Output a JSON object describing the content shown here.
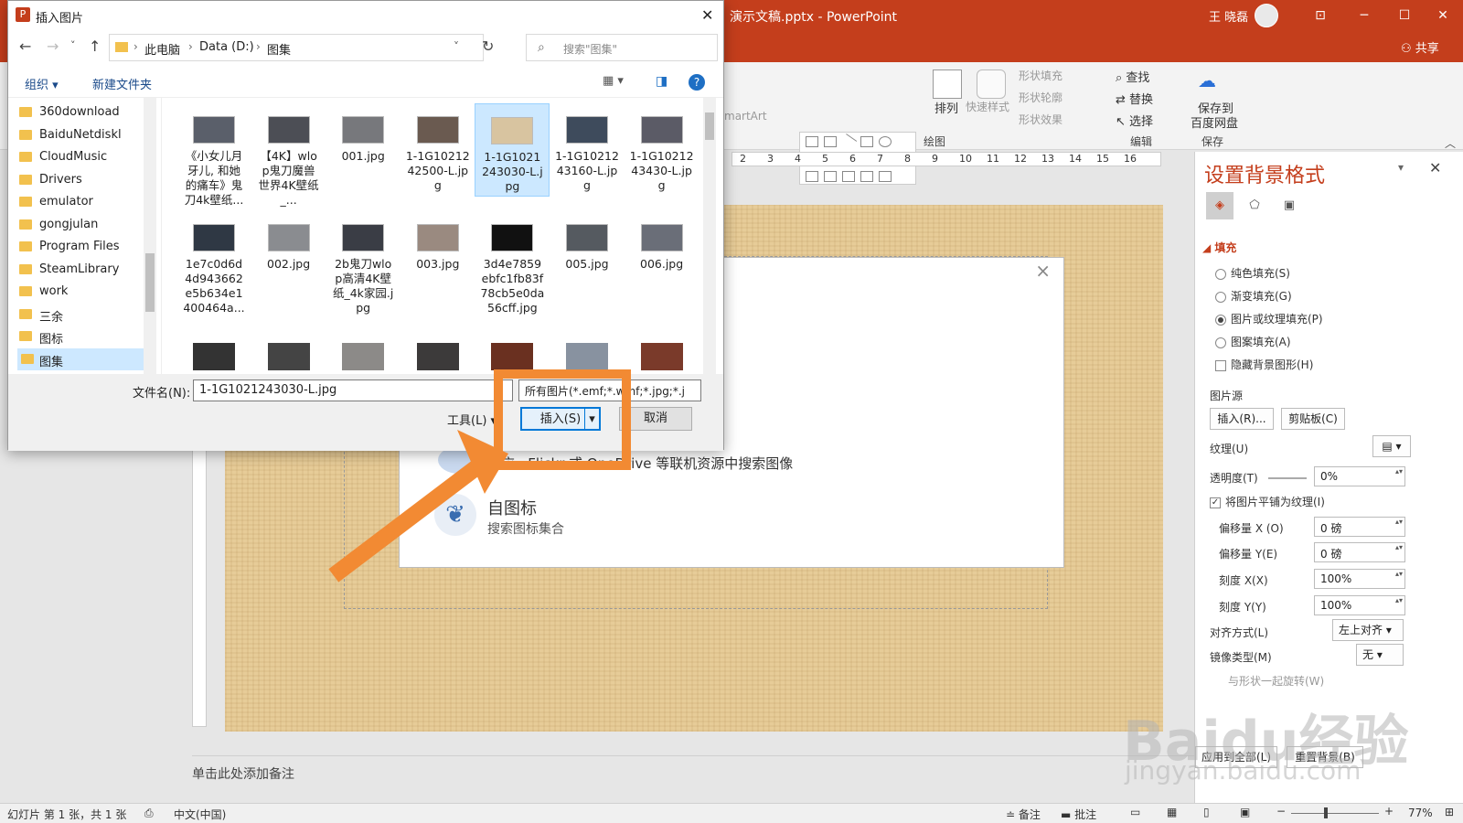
{
  "ppt": {
    "title": "演示文稿.pptx - PowerPoint",
    "user": "王 晓磊",
    "share": "共享",
    "ribbon": {
      "shape_fill": "形状填充",
      "shape_outline": "形状轮廓",
      "shape_effect": "形状效果",
      "arrange": "排列",
      "quick_styles": "快速样式",
      "find": "查找",
      "replace": "替换",
      "select": "选择",
      "save_to_baidu_line1": "保存到",
      "save_to_baidu_line2": "百度网盘",
      "group_drawing": "绘图",
      "group_edit": "编辑",
      "group_save": "保存",
      "smartart": "martArt"
    },
    "ruler_ticks": [
      "2",
      "3",
      "4",
      "5",
      "6",
      "7",
      "8",
      "9",
      "10",
      "11",
      "12",
      "13",
      "14",
      "15",
      "16"
    ],
    "notes_placeholder": "单击此处添加备注",
    "status": {
      "slide": "幻灯片 第 1 张，共 1 张",
      "lang": "中文(中国)",
      "notes": "备注",
      "comments": "批注",
      "zoom": "77%"
    }
  },
  "online_pictures": {
    "bing_text": "必应 · Flickr 或 OneDrive 等联机资源中搜索图像",
    "bing_partial": "Drive 等联机资源中搜索图像",
    "icons_title": "自图标",
    "icons_sub": "搜索图标集合"
  },
  "format_pane": {
    "title": "设置背景格式",
    "section_fill": "填充",
    "solid": "纯色填充(S)",
    "gradient": "渐变填充(G)",
    "picture_texture": "图片或纹理填充(P)",
    "pattern": "图案填充(A)",
    "hide_bg": "隐藏背景图形(H)",
    "picture_source": "图片源",
    "insert_btn": "插入(R)...",
    "clipboard_btn": "剪贴板(C)",
    "texture": "纹理(U)",
    "transparency": "透明度(T)",
    "transparency_val": "0%",
    "tile": "将图片平铺为纹理(I)",
    "offset_x": "偏移量 X (O)",
    "offset_x_val": "0 磅",
    "offset_y": "偏移量 Y(E)",
    "offset_y_val": "0 磅",
    "scale_x": "刻度 X(X)",
    "scale_x_val": "100%",
    "scale_y": "刻度 Y(Y)",
    "scale_y_val": "100%",
    "align": "对齐方式(L)",
    "align_val": "左上对齐",
    "mirror": "镜像类型(M)",
    "mirror_val": "无",
    "rotate_with_shape": "与形状一起旋转(W)",
    "apply_all": "应用到全部(L)",
    "reset_bg": "重置背景(B)"
  },
  "dialog": {
    "title": "插入图片",
    "breadcrumb": [
      "此电脑",
      "Data (D:)",
      "图集"
    ],
    "search_placeholder": "搜索\"图集\"",
    "organize": "组织",
    "new_folder": "新建文件夹",
    "nav_items": [
      "360download",
      "BaiduNetdiskl",
      "CloudMusic",
      "Drivers",
      "emulator",
      "gongjulan",
      "Program Files",
      "SteamLibrary",
      "work",
      "三余",
      "图标",
      "图集"
    ],
    "files": [
      "《小女儿月牙儿, 和她的痛车》鬼刀4k壁纸...",
      "【4K】wlop鬼刀魔兽世界4K壁纸_...",
      "001.jpg",
      "1-1G1021242500-L.jpg",
      "1-1G1021243030-L.jpg",
      "1-1G1021243160-L.jpg",
      "1-1G1021243430-L.jpg",
      "1e7c0d6d4d943662e5b634e1400464a...",
      "002.jpg",
      "2b鬼刀wlop高清4K壁纸_4k家园.jpg",
      "003.jpg",
      "3d4e7859ebfc1fb83f78cb5e0da56cff.jpg",
      "005.jpg",
      "006.jpg"
    ],
    "filename_label": "文件名(N):",
    "filename_value": "1-1G1021243030-L.jpg",
    "filetype_value": "所有图片(*.emf;*.wmf;*.jpg;*.j",
    "tools": "工具(L)",
    "insert": "插入(S)",
    "cancel": "取消"
  },
  "watermark": {
    "main": "Baidu经验",
    "sub": "jingyan.baidu.com"
  },
  "colors": {
    "ppt_accent": "#c43e1c",
    "highlight": "#f28a33",
    "selection": "#cce8ff"
  }
}
